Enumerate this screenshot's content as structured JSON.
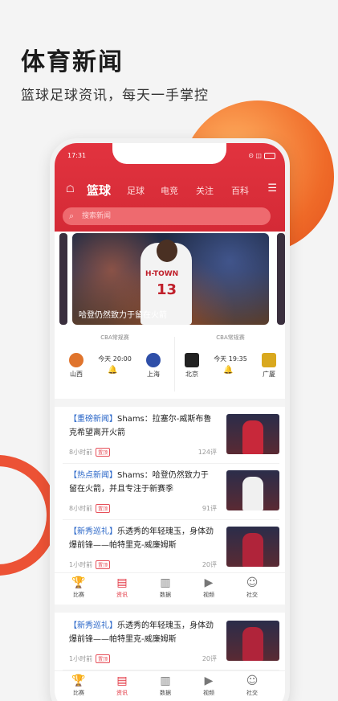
{
  "promo": {
    "title": "体育新闻",
    "subtitle": "篮球足球资讯，每天一手掌控"
  },
  "status_bar": {
    "time": "17:31",
    "right": "⊙ ◫"
  },
  "nav": {
    "tabs": [
      "篮球",
      "足球",
      "电竞",
      "关注",
      "百科"
    ],
    "active_tab": "篮球",
    "menu_glyph": "☰",
    "user_glyph": "☖"
  },
  "search": {
    "placeholder": "搜索新闻",
    "icon": "search-icon"
  },
  "banner": {
    "caption": "哈登仍然致力于留在火箭",
    "jersey_text": "H-TOWN",
    "jersey_number": "13"
  },
  "matches": [
    {
      "league": "CBA常规赛",
      "time": "今天 20:00",
      "home": "山西",
      "away": "上海",
      "home_color": "#e0742c",
      "away_color": "#2f4fa8"
    },
    {
      "league": "CBA常规赛",
      "time": "今天 19:35",
      "home": "北京",
      "away": "广厦",
      "home_color": "#222222",
      "away_color": "#d9a81e"
    }
  ],
  "news": [
    {
      "tag": "【重磅新闻】",
      "text": "Shams：拉塞尔-威斯布鲁克希望离开火箭",
      "time": "8小时前",
      "badge": "置顶",
      "comments": "124评"
    },
    {
      "tag": "【热点新闻】",
      "text": "Shams：哈登仍然致力于留在火箭，并且专注于新赛季",
      "time": "8小时前",
      "badge": "置顶",
      "comments": "91评"
    },
    {
      "tag": "【新秀巡礼】",
      "text": "乐透秀的年轻瑰玉，身体劲爆前锋——帕特里克-威廉姆斯",
      "time": "1小时前",
      "badge": "置顶",
      "comments": "20评"
    },
    {
      "tag": "【新秀巡礼】",
      "text": "乐透秀的年轻瑰玉，身体劲爆前锋——帕特里克-威廉姆斯",
      "time": "1小时前",
      "badge": "置顶",
      "comments": "20评"
    }
  ],
  "tabbar": [
    {
      "label": "比赛",
      "icon": "trophy-icon",
      "glyph": "🏆"
    },
    {
      "label": "资讯",
      "icon": "news-icon",
      "glyph": "▤"
    },
    {
      "label": "数据",
      "icon": "data-icon",
      "glyph": "▥"
    },
    {
      "label": "视频",
      "icon": "video-icon",
      "glyph": "▶"
    },
    {
      "label": "社交",
      "icon": "social-icon",
      "glyph": "☺"
    }
  ],
  "tabbar_active": "资讯",
  "colors": {
    "brand_red": "#e2333f",
    "tag_blue": "#2966c8",
    "accent_orange": "#ef6a28"
  }
}
